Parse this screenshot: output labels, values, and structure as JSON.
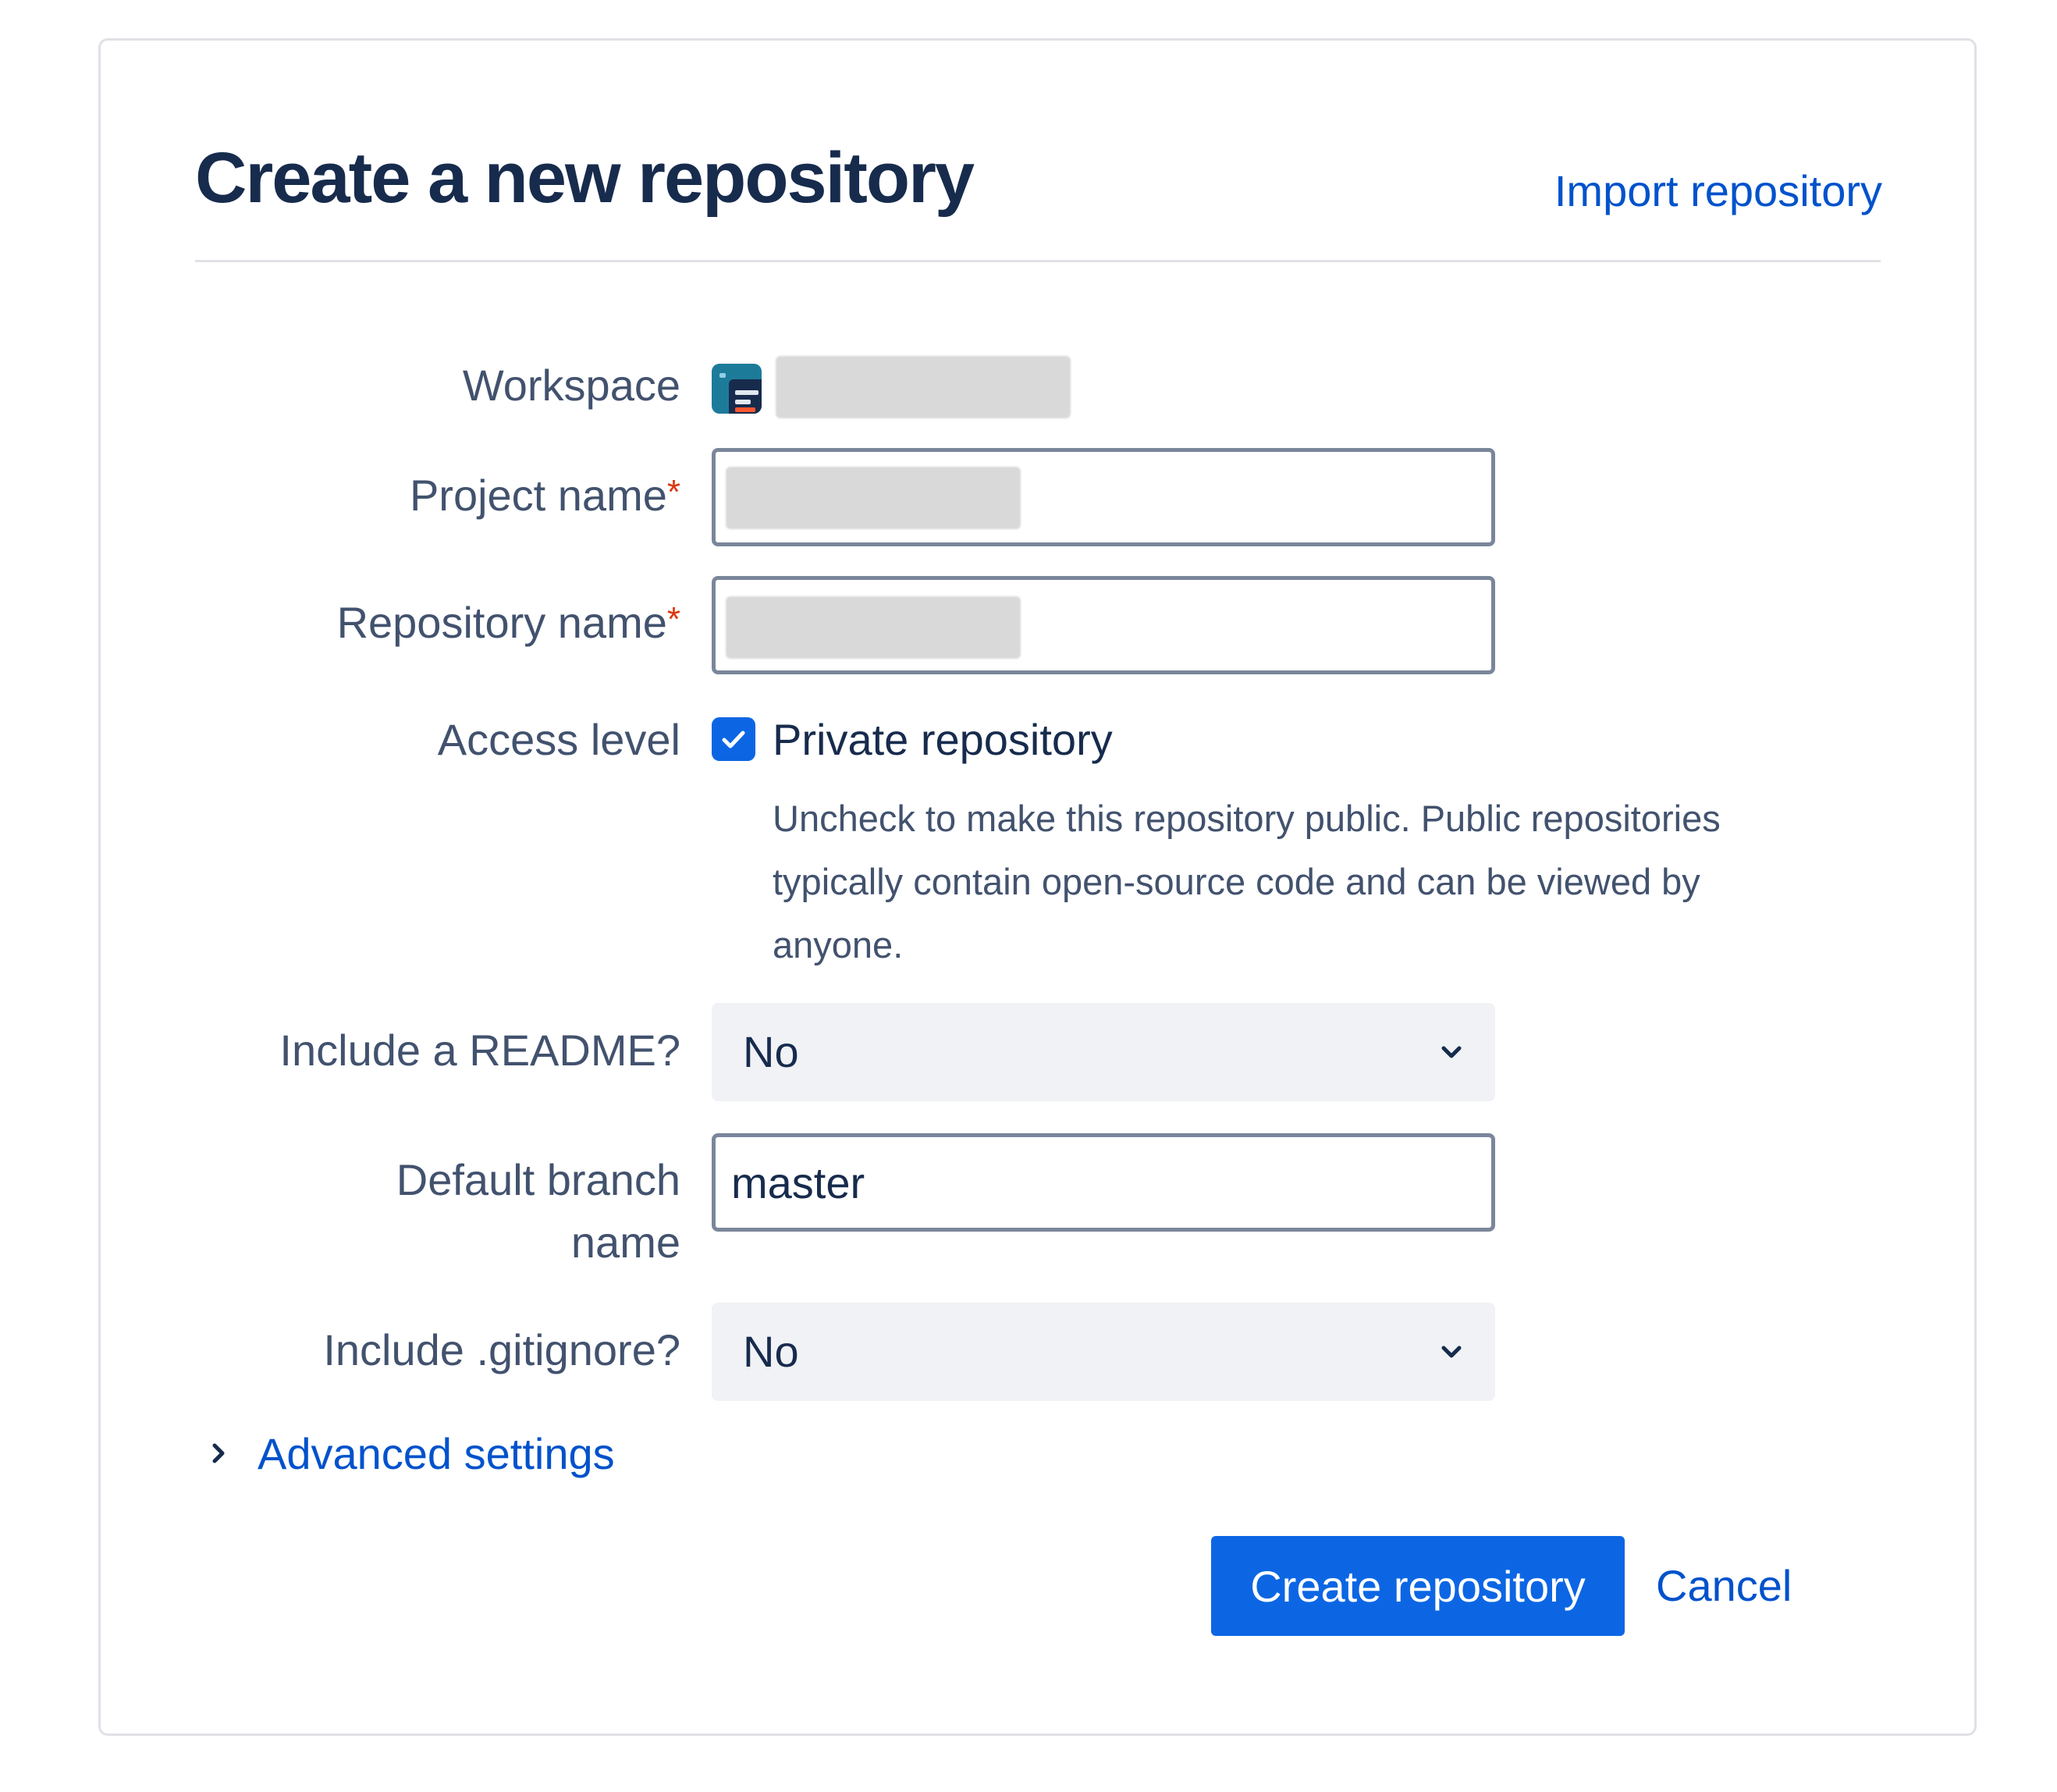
{
  "dialog": {
    "title": "Create a new repository",
    "import_link": "Import repository"
  },
  "form": {
    "workspace": {
      "label": "Workspace",
      "icon": "workspace-icon"
    },
    "project_name": {
      "label": "Project name",
      "required_mark": "*",
      "value": ""
    },
    "repository_name": {
      "label": "Repository name",
      "required_mark": "*",
      "value": ""
    },
    "access_level": {
      "label": "Access level",
      "checkbox_label": "Private repository",
      "checked": true,
      "help_text": "Uncheck to make this repository public. Public repositories typically contain open-source code and can be viewed by anyone."
    },
    "readme": {
      "label": "Include a README?",
      "selected": "No"
    },
    "default_branch": {
      "label": "Default branch name",
      "value": "master"
    },
    "gitignore": {
      "label": "Include .gitignore?",
      "selected": "No"
    },
    "advanced_settings": "Advanced settings"
  },
  "actions": {
    "create": "Create repository",
    "cancel": "Cancel"
  },
  "colors": {
    "accent": "#0c66e4",
    "link": "#0052cc",
    "required": "#de350b",
    "heading": "#172b4d",
    "label": "#42526e",
    "input_border": "#7a869a",
    "select_bg": "#f0f2f5",
    "workspace_icon": "#1d7b9a"
  }
}
